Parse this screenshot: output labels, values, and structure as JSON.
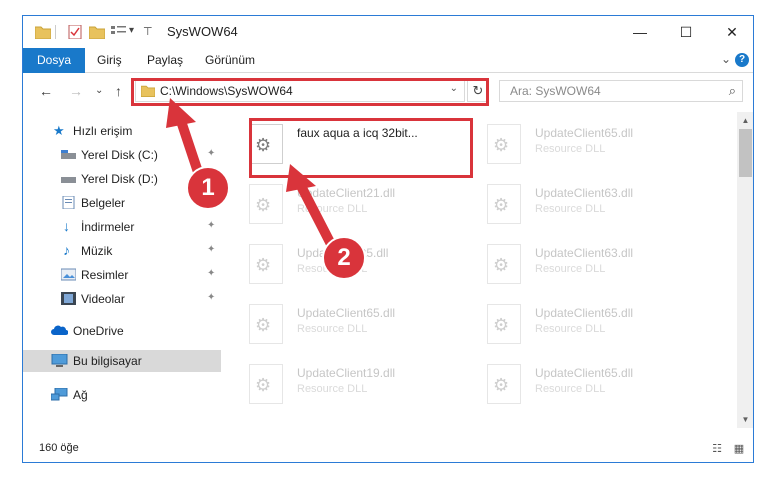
{
  "window": {
    "title": "SysWOW64",
    "controls": {
      "minimize": "—",
      "maximize": "☐",
      "close": "✕"
    }
  },
  "ribbon": {
    "tabs": [
      "Dosya",
      "Giriş",
      "Paylaş",
      "Görünüm"
    ],
    "expand_icon": "⌄",
    "help_icon": "?"
  },
  "nav": {
    "back": "←",
    "forward": "→",
    "recent": "⌄",
    "up": "↑",
    "address": "C:\\Windows\\SysWOW64",
    "refresh": "↻",
    "search_placeholder": "Ara: SysWOW64",
    "search_icon": "⌕"
  },
  "sidebar": {
    "items": [
      {
        "label": "Hızlı erişim",
        "icon": "star-icon"
      },
      {
        "label": "Yerel Disk (C:)",
        "icon": "drive-icon",
        "pinned": true
      },
      {
        "label": "Yerel Disk (D:)",
        "icon": "drive-icon"
      },
      {
        "label": "Belgeler",
        "icon": "documents-icon"
      },
      {
        "label": "İndirmeler",
        "icon": "download-icon",
        "pinned": true
      },
      {
        "label": "Müzik",
        "icon": "music-icon",
        "pinned": true
      },
      {
        "label": "Resimler",
        "icon": "pictures-icon",
        "pinned": true
      },
      {
        "label": "Videolar",
        "icon": "video-icon",
        "pinned": true
      },
      {
        "label": "OneDrive",
        "icon": "cloud-icon"
      },
      {
        "label": "Bu bilgisayar",
        "icon": "computer-icon",
        "selected": true
      },
      {
        "label": "Ağ",
        "icon": "network-icon"
      }
    ],
    "pin_icon": "📌"
  },
  "files": {
    "highlighted": {
      "name": "faux aqua a icq 32bit...",
      "type": ""
    },
    "left_column": [
      {
        "name": "UpdateClient21.dll",
        "type": "Resource DLL"
      },
      {
        "name": "UpdateClient5.dll",
        "type": "Resource DLL"
      },
      {
        "name": "UpdateClient65.dll",
        "type": "Resource DLL"
      },
      {
        "name": "UpdateClient19.dll",
        "type": "Resource DLL"
      }
    ],
    "right_column": [
      {
        "name": "UpdateClient65.dll",
        "type": "Resource DLL"
      },
      {
        "name": "UpdateClient63.dll",
        "type": "Resource DLL"
      },
      {
        "name": "UpdateClient63.dll",
        "type": "Resource DLL"
      },
      {
        "name": "UpdateClient65.dll",
        "type": "Resource DLL"
      },
      {
        "name": "UpdateClient65.dll",
        "type": "Resource DLL"
      }
    ],
    "gear_glyph": "⚙"
  },
  "status": {
    "count": "160 öğe"
  },
  "annotations": {
    "step1": "1",
    "step2": "2",
    "color": "#d9343b"
  }
}
